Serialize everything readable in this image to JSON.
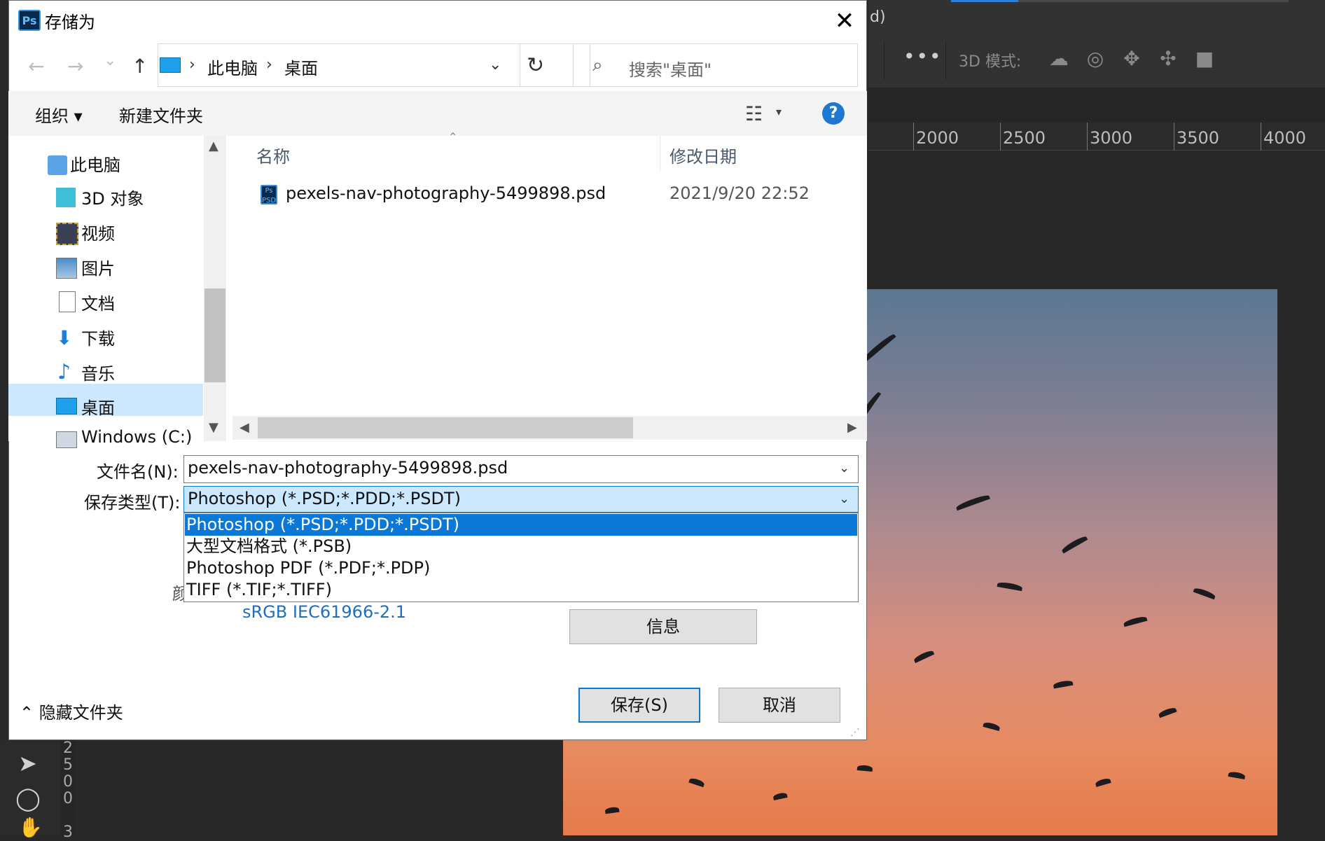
{
  "dialog": {
    "title": "存储为",
    "app_logo": "Ps",
    "close_icon": "✕"
  },
  "nav": {
    "back": "←",
    "forward": "→",
    "recent": "⌄",
    "up": "↑",
    "breadcrumb": [
      "此电脑",
      "桌面"
    ],
    "refresh": "↻",
    "search_placeholder": "搜索\"桌面\""
  },
  "toolbar": {
    "organize": "组织 ▾",
    "new_folder": "新建文件夹",
    "help": "?"
  },
  "sidebar": {
    "items": [
      {
        "label": "此电脑",
        "icon": "computer-icon"
      },
      {
        "label": "3D 对象",
        "icon": "cube-icon"
      },
      {
        "label": "视频",
        "icon": "video-icon"
      },
      {
        "label": "图片",
        "icon": "picture-icon"
      },
      {
        "label": "文档",
        "icon": "document-icon"
      },
      {
        "label": "下载",
        "icon": "download-icon"
      },
      {
        "label": "音乐",
        "icon": "music-icon"
      },
      {
        "label": "桌面",
        "icon": "desktop-icon",
        "selected": true
      },
      {
        "label": "Windows (C:)",
        "icon": "drive-icon"
      }
    ]
  },
  "files": {
    "columns": [
      "名称",
      "修改日期"
    ],
    "rows": [
      {
        "name": "pexels-nav-photography-5499898.psd",
        "date": "2021/9/20 22:52",
        "icon": "ps-file-icon"
      }
    ]
  },
  "form": {
    "filename_label": "文件名(N):",
    "filename_value": "pexels-nav-photography-5499898.psd",
    "type_label": "保存类型(T):",
    "type_value": "Photoshop (*.PSD;*.PDD;*.PSDT)",
    "type_options": [
      "Photoshop (*.PSD;*.PDD;*.PSDT)",
      "大型文档格式 (*.PSB)",
      "Photoshop PDF (*.PDF;*.PDP)",
      "TIFF (*.TIF;*.TIFF)"
    ],
    "partial_char": "颜",
    "icc_profile": "sRGB IEC61966-2.1",
    "info_button": "信息"
  },
  "footer": {
    "hide_folders": "隐藏文件夹",
    "save": "保存(S)",
    "cancel": "取消"
  },
  "photoshop": {
    "title_fragment": "d)",
    "mode_label": "3D 模式:",
    "more": "•••",
    "ruler": [
      "2000",
      "2500",
      "3000",
      "3500",
      "4000"
    ],
    "vruler": [
      "2",
      "5",
      "0",
      "0",
      "3"
    ]
  },
  "colors": {
    "accent": "#0b78d7",
    "selection_bg": "#cce8ff",
    "ps_bg": "#282828"
  }
}
